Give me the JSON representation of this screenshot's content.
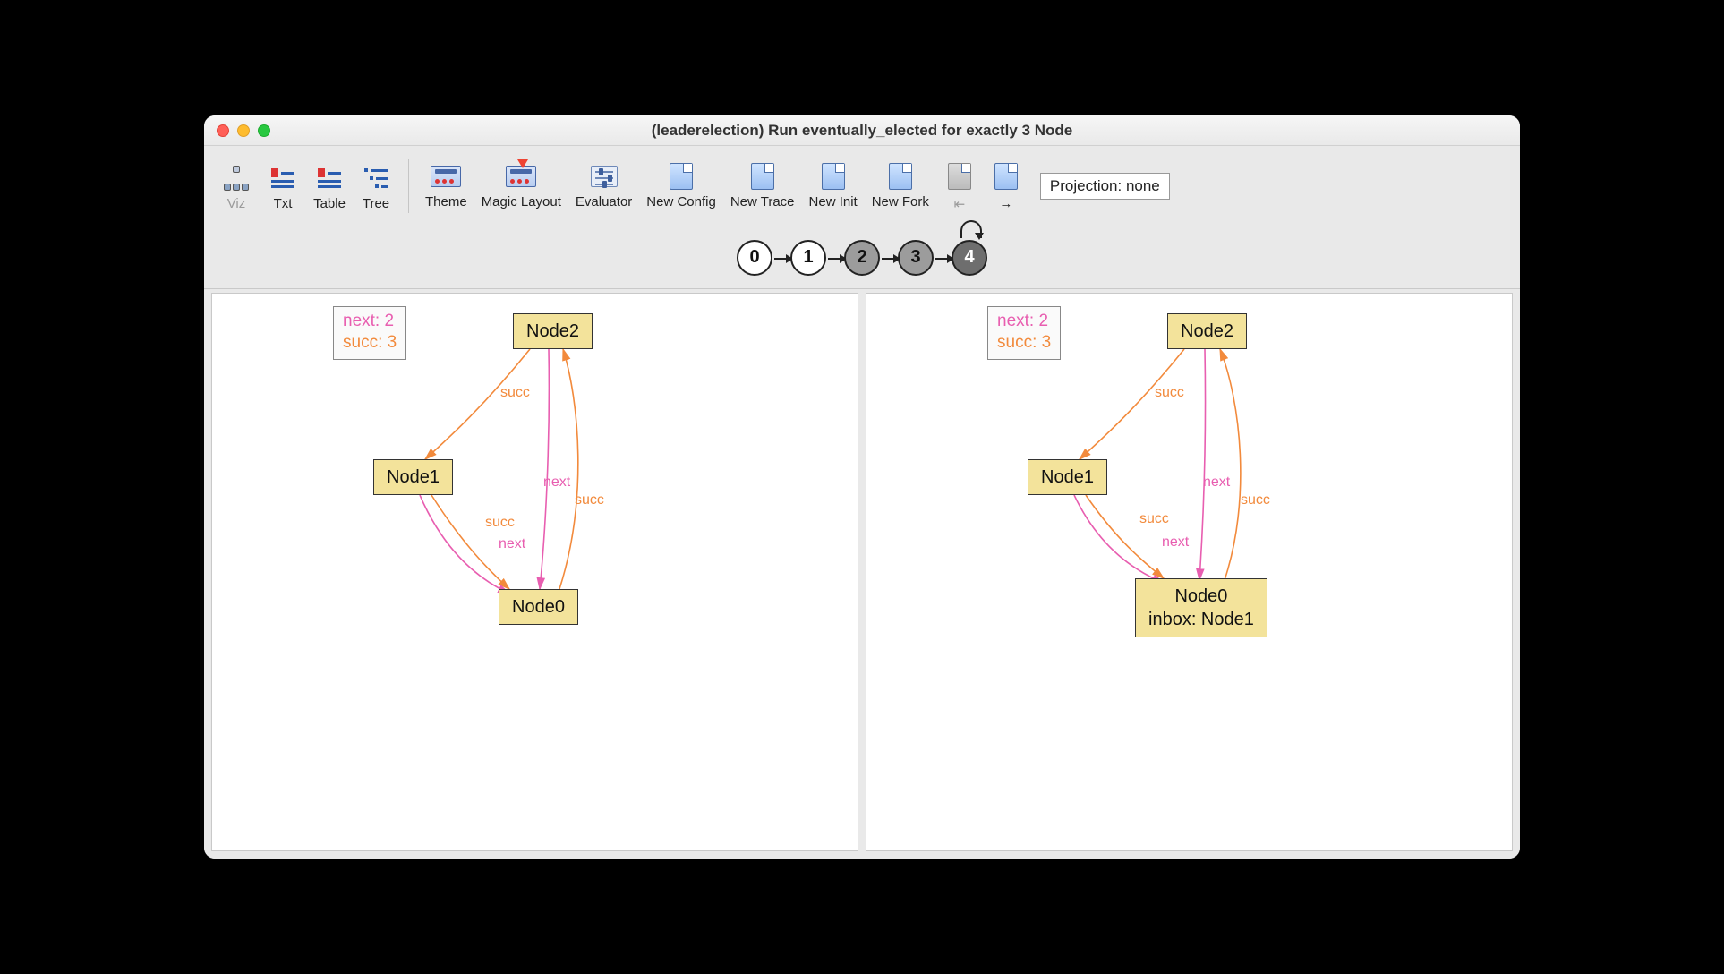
{
  "title": "(leaderelection) Run eventually_elected for exactly 3 Node",
  "toolbar": {
    "viz": "Viz",
    "txt": "Txt",
    "table": "Table",
    "tree": "Tree",
    "theme": "Theme",
    "magic_layout": "Magic Layout",
    "evaluator": "Evaluator",
    "new_config": "New Config",
    "new_trace": "New Trace",
    "new_init": "New Init",
    "new_fork": "New Fork",
    "projection": "Projection: none"
  },
  "trace": {
    "states": [
      "0",
      "1",
      "2",
      "3",
      "4"
    ],
    "done": [
      2,
      3
    ],
    "current": 4,
    "self_loop_on": 4
  },
  "legend": {
    "next_label": "next:",
    "next_count": "2",
    "succ_label": "succ:",
    "succ_count": "3"
  },
  "left": {
    "nodes": {
      "n2": "Node2",
      "n1": "Node1",
      "n0": "Node0"
    },
    "edge_labels": {
      "succ": "succ",
      "next": "next"
    }
  },
  "right": {
    "nodes": {
      "n2": "Node2",
      "n1": "Node1",
      "n0_line1": "Node0",
      "n0_line2": "inbox: Node1"
    },
    "edge_labels": {
      "succ": "succ",
      "next": "next"
    }
  }
}
